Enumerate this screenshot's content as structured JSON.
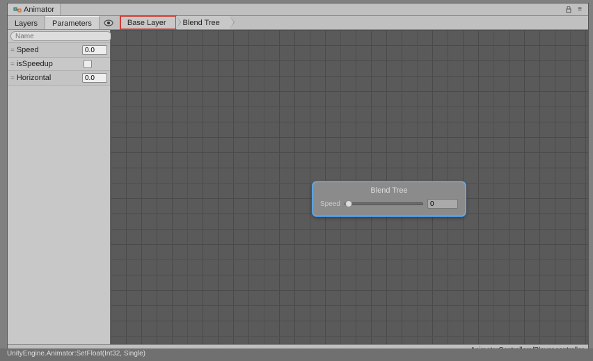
{
  "window": {
    "title": "Animator"
  },
  "modes": {
    "layers": "Layers",
    "parameters": "Parameters"
  },
  "breadcrumb": {
    "base": "Base Layer",
    "blend": "Blend Tree"
  },
  "search": {
    "placeholder": "Name"
  },
  "params": [
    {
      "name": "Speed",
      "type": "float",
      "value": "0.0"
    },
    {
      "name": "isSpeedup",
      "type": "bool"
    },
    {
      "name": "Horizontal",
      "type": "float",
      "value": "0.0"
    }
  ],
  "node": {
    "title": "Blend Tree",
    "param": "Speed",
    "value": "0"
  },
  "status": "AnimatorControllers/Player.controller",
  "bottom": "UnityEngine.Animator:SetFloat(Int32, Single)"
}
